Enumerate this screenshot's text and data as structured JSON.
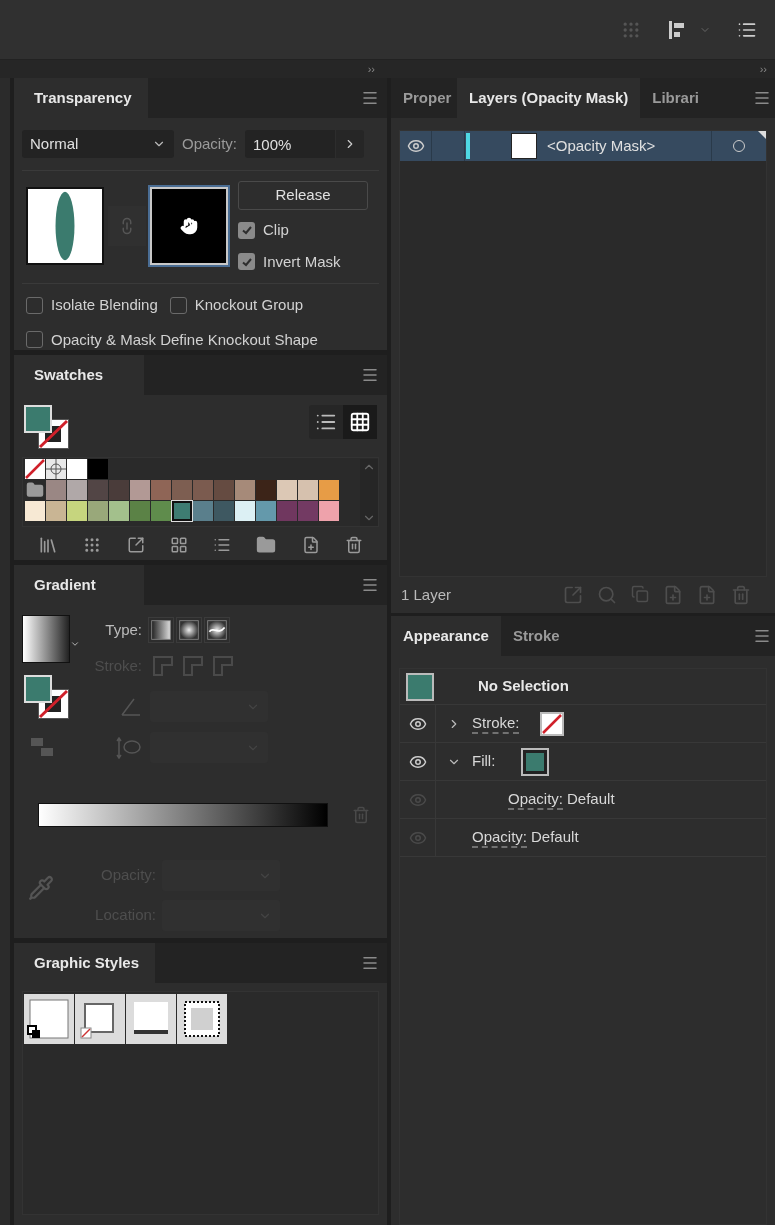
{
  "dock": {
    "left_collapse": "››",
    "right_collapse": "››"
  },
  "transparency": {
    "title": "Transparency",
    "blend_mode": "Normal",
    "opacity_label": "Opacity:",
    "opacity_value": "100%",
    "release_label": "Release",
    "mask_options": [
      {
        "label": "Clip",
        "checked": true
      },
      {
        "label": "Invert Mask",
        "checked": true
      }
    ],
    "options": [
      {
        "label": "Isolate Blending",
        "checked": false
      },
      {
        "label": "Knockout Group",
        "checked": false
      },
      {
        "label": "Opacity & Mask Define Knockout Shape",
        "checked": false
      }
    ]
  },
  "swatches": {
    "title": "Swatches",
    "current_fill": {
      "color": "#3b7b6e"
    },
    "view_options": [
      {
        "kind": "list",
        "selected": false
      },
      {
        "kind": "grid",
        "selected": true
      }
    ],
    "rows": [
      [
        {
          "kind": "none",
          "selected": false
        },
        {
          "kind": "registration",
          "selected": false
        },
        {
          "kind": "color",
          "color": "#ffffff",
          "selected": false
        },
        {
          "kind": "color",
          "color": "#000000",
          "selected": false
        }
      ],
      [
        {
          "kind": "folder"
        },
        {
          "kind": "color",
          "color": "#9a8784",
          "selected": false
        },
        {
          "kind": "color",
          "color": "#b0a8a8",
          "selected": false
        },
        {
          "kind": "color",
          "color": "#524545",
          "selected": false
        },
        {
          "kind": "color",
          "color": "#4a3c3a",
          "selected": false
        },
        {
          "kind": "color",
          "color": "#b29995",
          "selected": false
        },
        {
          "kind": "color",
          "color": "#8f6556",
          "selected": false
        },
        {
          "kind": "color",
          "color": "#7d5e51",
          "selected": false
        },
        {
          "kind": "color",
          "color": "#7b5b4f",
          "selected": false
        },
        {
          "kind": "color",
          "color": "#654b41",
          "selected": false
        },
        {
          "kind": "color",
          "color": "#a68a79",
          "selected": false
        },
        {
          "kind": "color",
          "color": "#3c2418",
          "selected": false
        },
        {
          "kind": "color",
          "color": "#dcc8b5",
          "selected": false
        },
        {
          "kind": "color",
          "color": "#d6c1ae",
          "selected": false
        },
        {
          "kind": "color",
          "color": "#e79c46",
          "selected": false
        }
      ],
      [
        {
          "kind": "color",
          "color": "#f7e9d4",
          "selected": false
        },
        {
          "kind": "color",
          "color": "#c9b594",
          "selected": false
        },
        {
          "kind": "color",
          "color": "#c6d57e",
          "selected": false
        },
        {
          "kind": "color",
          "color": "#99a87a",
          "selected": false
        },
        {
          "kind": "color",
          "color": "#a3c08c",
          "selected": false
        },
        {
          "kind": "color",
          "color": "#5b8246",
          "selected": false
        },
        {
          "kind": "color",
          "color": "#5f8c4c",
          "selected": false
        },
        {
          "kind": "color",
          "color": "#3e7c72",
          "selected": true
        },
        {
          "kind": "color",
          "color": "#5a7f8c",
          "selected": false
        },
        {
          "kind": "color",
          "color": "#3e5861",
          "selected": false
        },
        {
          "kind": "color",
          "color": "#dcf0f4",
          "selected": false
        },
        {
          "kind": "color",
          "color": "#6499ab",
          "selected": false
        },
        {
          "kind": "color",
          "color": "#70375f",
          "selected": false
        },
        {
          "kind": "color",
          "color": "#733a63",
          "selected": false
        },
        {
          "kind": "color",
          "color": "#eea2ab",
          "selected": false
        }
      ]
    ]
  },
  "gradient": {
    "title": "Gradient",
    "type_label": "Type:",
    "stroke_label": "Stroke:",
    "opacity_label": "Opacity:",
    "location_label": "Location:",
    "controls_disabled": true
  },
  "graphic_styles": {
    "title": "Graphic Styles"
  },
  "layers_panel": {
    "tabs": [
      {
        "label": "Proper",
        "selected": false
      },
      {
        "label": "Layers (Opacity Mask)",
        "selected": true
      },
      {
        "label": "Librari",
        "selected": false
      }
    ],
    "rows": [
      {
        "name": "<Opacity Mask>",
        "selected": true
      }
    ],
    "footer": "1 Layer"
  },
  "appearance_panel": {
    "tabs": [
      {
        "label": "Appearance",
        "selected": true
      },
      {
        "label": "Stroke",
        "selected": false
      }
    ],
    "header": "No Selection",
    "rows": [
      {
        "kind": "stroke",
        "label": "Stroke:",
        "expanded": false,
        "eye_active": true,
        "children": []
      },
      {
        "kind": "fill",
        "label": "Fill:",
        "expanded": true,
        "eye_active": true,
        "children": [
          {
            "kind": "opacity",
            "label": "Opacity:",
            "value": "Default",
            "eye_active": false
          }
        ]
      },
      {
        "kind": "opacity",
        "label": "Opacity:",
        "value": "Default",
        "eye_active": false
      }
    ]
  }
}
